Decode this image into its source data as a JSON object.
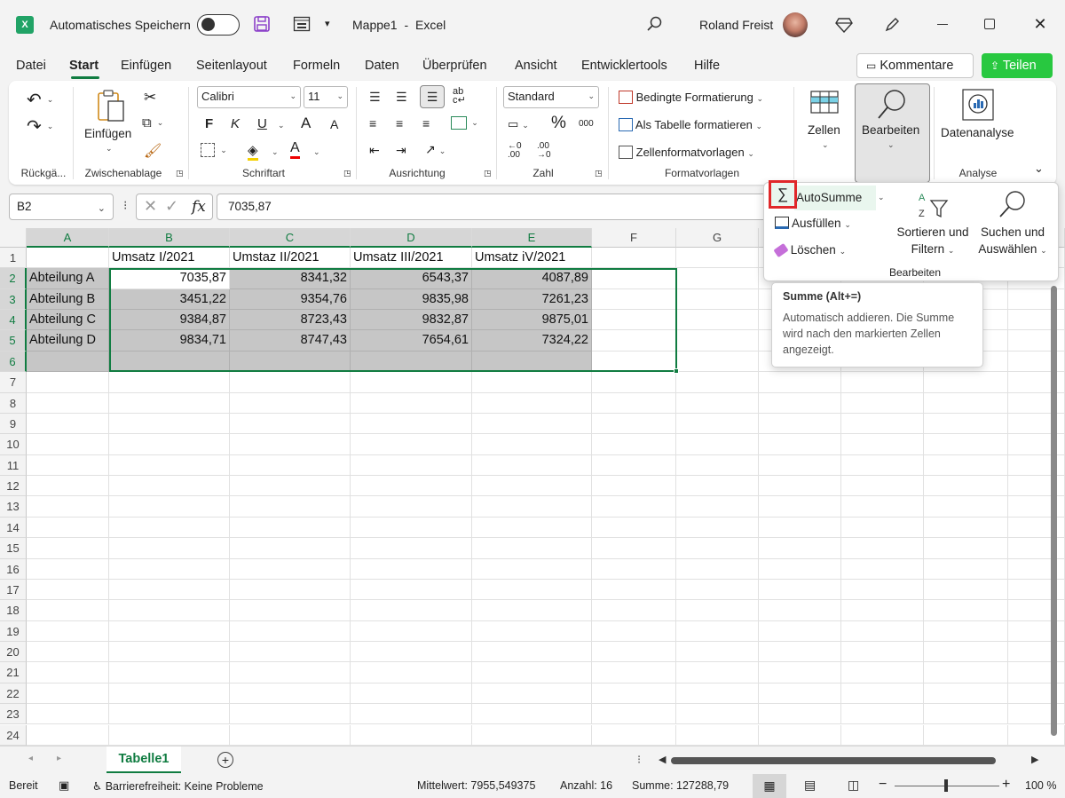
{
  "titlebar": {
    "autosave_label": "Automatisches Speichern",
    "filename": "Mappe1",
    "app_separator": "-",
    "app": "Excel",
    "user": "Roland Freist"
  },
  "menu": {
    "tabs": [
      "Datei",
      "Start",
      "Einfügen",
      "Seitenlayout",
      "Formeln",
      "Daten",
      "Überprüfen",
      "Ansicht",
      "Entwicklertools",
      "Hilfe"
    ],
    "active": "Start",
    "comments_label": "Kommentare",
    "share_label": "Teilen"
  },
  "ribbon": {
    "groups": {
      "undo": "Rückgä...",
      "clipboard": "Zwischenablage",
      "font": "Schriftart",
      "alignment": "Ausrichtung",
      "number": "Zahl",
      "styles": "Formatvorlagen",
      "analysis": "Analyse"
    },
    "paste_label": "Einfügen",
    "font_name": "Calibri",
    "font_size": "11",
    "bold": "F",
    "italic": "K",
    "underline": "U",
    "grow": "A",
    "shrink": "A",
    "color_a": "A",
    "number_format": "Standard",
    "percent": "%",
    "thousands": "000",
    "conditional": "Bedingte Formatierung",
    "as_table": "Als Tabelle formatieren",
    "cell_styles": "Zellenformatvorlagen",
    "cells_label": "Zellen",
    "editing_label": "Bearbeiten",
    "data_analysis_label": "Datenanalyse"
  },
  "formula_bar": {
    "name_box": "B2",
    "fx": "fx",
    "value": "7035,87"
  },
  "columns": [
    "A",
    "B",
    "C",
    "D",
    "E",
    "F",
    "G"
  ],
  "rows": [
    "1",
    "2",
    "3",
    "4",
    "5",
    "6",
    "7",
    "8",
    "9",
    "10",
    "11",
    "12",
    "13",
    "14",
    "15",
    "16",
    "17",
    "18",
    "19",
    "20",
    "21",
    "22",
    "23",
    "24"
  ],
  "table": {
    "headers": [
      "Umsatz I/2021",
      "Umstaz II/2021",
      "Umsatz III/2021",
      "Umsatz iV/2021"
    ],
    "rows": [
      {
        "label": "Abteilung A",
        "values": [
          "7035,87",
          "8341,32",
          "6543,37",
          "4087,89"
        ]
      },
      {
        "label": "Abteilung B",
        "values": [
          "3451,22",
          "9354,76",
          "9835,98",
          "7261,23"
        ]
      },
      {
        "label": "Abteilung C",
        "values": [
          "9384,87",
          "8723,43",
          "9832,87",
          "9875,01"
        ]
      },
      {
        "label": "Abteilung D",
        "values": [
          "9834,71",
          "8747,43",
          "7654,61",
          "7324,22"
        ]
      }
    ]
  },
  "popup": {
    "autosum": "AutoSumme",
    "fill": "Ausfüllen",
    "clear": "Löschen",
    "sort_line1": "Sortieren und",
    "sort_line2": "Filtern",
    "find_line1": "Suchen und",
    "find_line2": "Auswählen",
    "group": "Bearbeiten"
  },
  "tooltip": {
    "title": "Summe (Alt+=)",
    "body": "Automatisch addieren. Die Summe wird nach den markierten Zellen angezeigt."
  },
  "sheets": {
    "active": "Tabelle1"
  },
  "status": {
    "ready": "Bereit",
    "accessibility": "Barrierefreiheit: Keine Probleme",
    "average": "Mittelwert: 7955,549375",
    "count": "Anzahl: 16",
    "sum": "Summe: 127288,79",
    "zoom": "100 %",
    "zoom_level": 1.0
  },
  "colors": {
    "accent": "#107c41",
    "share": "#28c840",
    "highlight_box": "#e0282a",
    "selection": "#c6c6c6"
  }
}
